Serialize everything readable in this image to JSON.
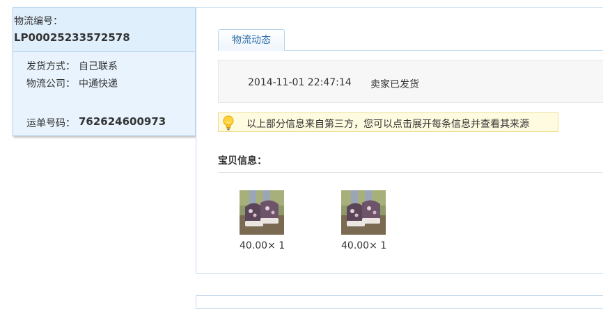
{
  "side": {
    "logistics_no_label": "物流编号：",
    "logistics_no": "LP00025233572578",
    "ship_method_label": "发货方式：",
    "ship_method": "自己联系",
    "company_label": "物流公司：",
    "company": "中通快递",
    "waybill_label": "运单号码：",
    "waybill_no": "762624600973"
  },
  "tabs": [
    {
      "label": "物流动态"
    }
  ],
  "events": [
    {
      "time": "2014-11-01 22:47:14",
      "status": "卖家已发货"
    }
  ],
  "notice": {
    "icon": "lightbulb-icon",
    "text": "以上部分信息来自第三方，您可以点击展开每条信息并查看其来源"
  },
  "products": {
    "title": "宝贝信息：",
    "items": [
      {
        "price": "40.00× 1"
      },
      {
        "price": "40.00× 1"
      }
    ]
  },
  "colors": {
    "panel_bg": "#e8f3fd",
    "border": "#b8d4ee",
    "tab_text": "#2d6fa8",
    "notice_bg": "#fffbe0",
    "notice_border": "#f0dc8c"
  }
}
